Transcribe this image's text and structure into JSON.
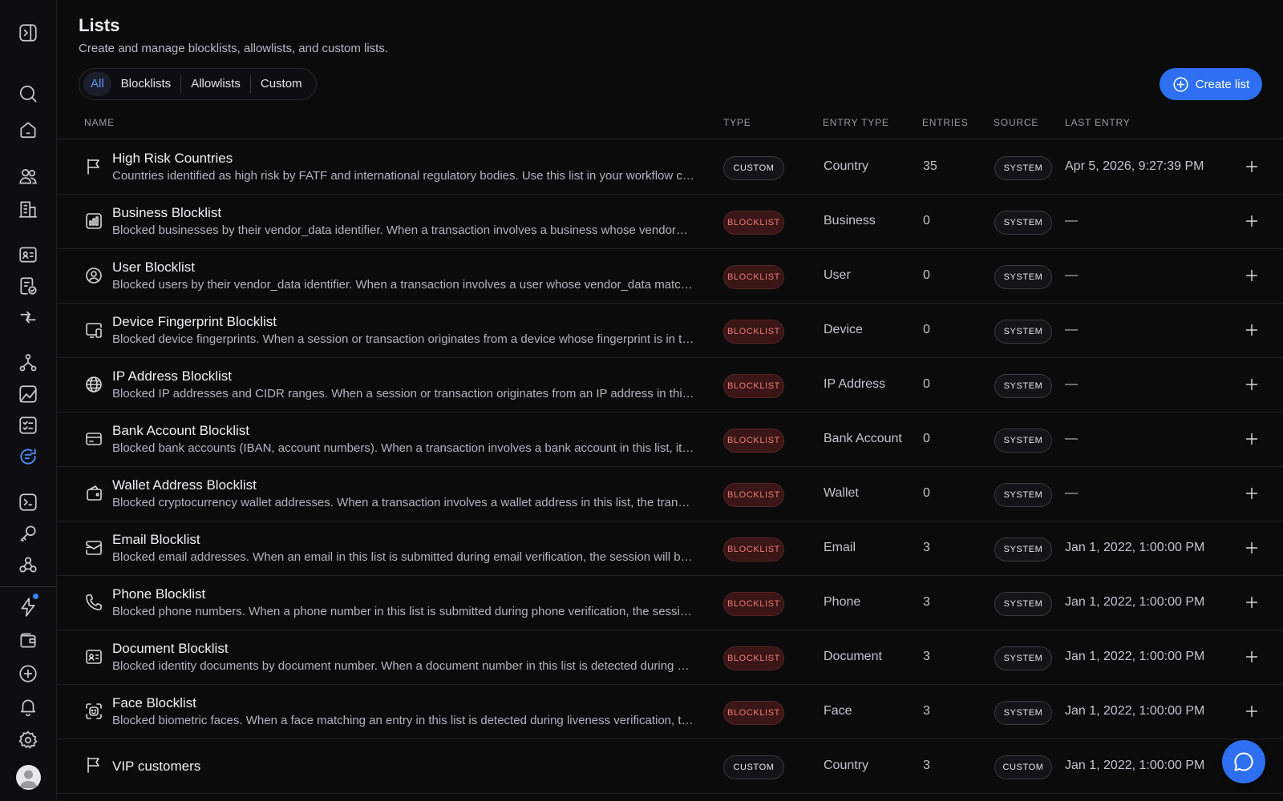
{
  "page": {
    "title": "Lists",
    "subtitle": "Create and manage blocklists, allowlists, and custom lists."
  },
  "filters": [
    {
      "label": "All",
      "active": true
    },
    {
      "label": "Blocklists",
      "active": false
    },
    {
      "label": "Allowlists",
      "active": false
    },
    {
      "label": "Custom",
      "active": false
    }
  ],
  "create_button": {
    "label": "Create list",
    "icon": "plus-circle-icon"
  },
  "columns": {
    "name": "NAME",
    "type": "TYPE",
    "entry_type": "ENTRY TYPE",
    "entries": "ENTRIES",
    "source": "SOURCE",
    "last_entry": "LAST ENTRY"
  },
  "rows": [
    {
      "icon": "flag-icon",
      "name": "High Risk Countries",
      "description": "Countries identified as high risk by FATF and international regulatory bodies. Use this list in your workflow conditions to flag or block transactions.",
      "type": "CUSTOM",
      "type_style": "custom",
      "entry_type": "Country",
      "entries": "35",
      "source": "SYSTEM",
      "last_entry": "Apr 5, 2026, 9:27:39 PM"
    },
    {
      "icon": "building-icon",
      "name": "Business Blocklist",
      "description": "Blocked businesses by their vendor_data identifier. When a transaction involves a business whose vendor_data matches, it is blocked.",
      "type": "BLOCKLIST",
      "type_style": "blocklist",
      "entry_type": "Business",
      "entries": "0",
      "source": "SYSTEM",
      "last_entry": "—"
    },
    {
      "icon": "user-circle-icon",
      "name": "User Blocklist",
      "description": "Blocked users by their vendor_data identifier. When a transaction involves a user whose vendor_data matches, it is blocked.",
      "type": "BLOCKLIST",
      "type_style": "blocklist",
      "entry_type": "User",
      "entries": "0",
      "source": "SYSTEM",
      "last_entry": "—"
    },
    {
      "icon": "device-icon",
      "name": "Device Fingerprint Blocklist",
      "description": "Blocked device fingerprints. When a session or transaction originates from a device whose fingerprint is in this list, it is blocked.",
      "type": "BLOCKLIST",
      "type_style": "blocklist",
      "entry_type": "Device",
      "entries": "0",
      "source": "SYSTEM",
      "last_entry": "—"
    },
    {
      "icon": "globe-icon",
      "name": "IP Address Blocklist",
      "description": "Blocked IP addresses and CIDR ranges. When a session or transaction originates from an IP address in this list, it is blocked.",
      "type": "BLOCKLIST",
      "type_style": "blocklist",
      "entry_type": "IP Address",
      "entries": "0",
      "source": "SYSTEM",
      "last_entry": "—"
    },
    {
      "icon": "bank-card-icon",
      "name": "Bank Account Blocklist",
      "description": "Blocked bank accounts (IBAN, account numbers). When a transaction involves a bank account in this list, it is blocked.",
      "type": "BLOCKLIST",
      "type_style": "blocklist",
      "entry_type": "Bank Account",
      "entries": "0",
      "source": "SYSTEM",
      "last_entry": "—"
    },
    {
      "icon": "wallet-icon",
      "name": "Wallet Address Blocklist",
      "description": "Blocked cryptocurrency wallet addresses. When a transaction involves a wallet address in this list, the transaction is blocked.",
      "type": "BLOCKLIST",
      "type_style": "blocklist",
      "entry_type": "Wallet",
      "entries": "0",
      "source": "SYSTEM",
      "last_entry": "—"
    },
    {
      "icon": "mail-icon",
      "name": "Email Blocklist",
      "description": "Blocked email addresses. When an email in this list is submitted during email verification, the session will be declined.",
      "type": "BLOCKLIST",
      "type_style": "blocklist",
      "entry_type": "Email",
      "entries": "3",
      "source": "SYSTEM",
      "last_entry": "Jan 1, 2022, 1:00:00 PM"
    },
    {
      "icon": "phone-icon",
      "name": "Phone Blocklist",
      "description": "Blocked phone numbers. When a phone number in this list is submitted during phone verification, the session will be declined.",
      "type": "BLOCKLIST",
      "type_style": "blocklist",
      "entry_type": "Phone",
      "entries": "3",
      "source": "SYSTEM",
      "last_entry": "Jan 1, 2022, 1:00:00 PM"
    },
    {
      "icon": "id-card-icon",
      "name": "Document Blocklist",
      "description": "Blocked identity documents by document number. When a document number in this list is detected during verification, the session is declined.",
      "type": "BLOCKLIST",
      "type_style": "blocklist",
      "entry_type": "Document",
      "entries": "3",
      "source": "SYSTEM",
      "last_entry": "Jan 1, 2022, 1:00:00 PM"
    },
    {
      "icon": "face-scan-icon",
      "name": "Face Blocklist",
      "description": "Blocked biometric faces. When a face matching an entry in this list is detected during liveness verification, the session is declined.",
      "type": "BLOCKLIST",
      "type_style": "blocklist",
      "entry_type": "Face",
      "entries": "3",
      "source": "SYSTEM",
      "last_entry": "Jan 1, 2022, 1:00:00 PM"
    },
    {
      "icon": "flag-icon",
      "name": "VIP customers",
      "description": "",
      "type": "CUSTOM",
      "type_style": "custom",
      "entry_type": "Country",
      "entries": "3",
      "source": "CUSTOM",
      "last_entry": "Jan 1, 2022, 1:00:00 PM"
    }
  ],
  "sidebar": {
    "items": [
      {
        "icon": "sidebar-toggle-icon"
      },
      {
        "icon": "search-icon"
      },
      {
        "icon": "home-icon"
      },
      {
        "icon": "users-icon"
      },
      {
        "icon": "building-icon"
      },
      {
        "icon": "id-card-icon"
      },
      {
        "icon": "document-check-icon"
      },
      {
        "icon": "transfer-arrows-icon"
      },
      {
        "icon": "workflow-icon"
      },
      {
        "icon": "analytics-icon"
      },
      {
        "icon": "checklist-icon"
      },
      {
        "icon": "lists-icon",
        "active": true
      },
      {
        "icon": "terminal-icon"
      },
      {
        "icon": "key-icon"
      },
      {
        "icon": "webhook-icon"
      },
      {
        "icon": "lightning-icon"
      },
      {
        "icon": "wallet-icon"
      },
      {
        "icon": "plus-circle-icon"
      },
      {
        "icon": "bell-icon"
      },
      {
        "icon": "gear-icon"
      }
    ]
  },
  "colors": {
    "accent": "#2d6ff0",
    "active_icon": "#4f8df5",
    "blocklist_text": "#f07a7a",
    "blocklist_bg": "#3a1616"
  }
}
